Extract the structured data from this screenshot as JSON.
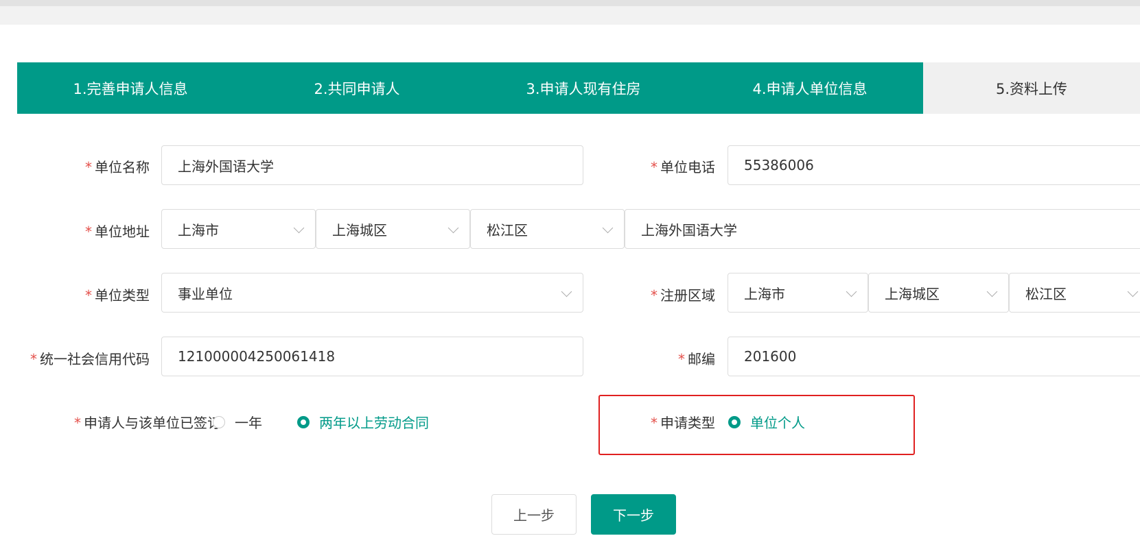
{
  "steps": [
    {
      "label": "1.完善申请人信息",
      "active": true
    },
    {
      "label": "2.共同申请人",
      "active": true
    },
    {
      "label": "3.申请人现有住房",
      "active": true
    },
    {
      "label": "4.申请人单位信息",
      "active": true
    },
    {
      "label": "5.资料上传",
      "active": false
    }
  ],
  "required_mark": "*",
  "form": {
    "company_name": {
      "label": "单位名称",
      "value": "上海外国语大学"
    },
    "company_phone": {
      "label": "单位电话",
      "value": "55386006"
    },
    "company_address": {
      "label": "单位地址",
      "province": "上海市",
      "city": "上海城区",
      "district": "松江区",
      "detail": "上海外国语大学"
    },
    "company_type": {
      "label": "单位类型",
      "value": "事业单位"
    },
    "register_region": {
      "label": "注册区域",
      "province": "上海市",
      "city": "上海城区",
      "district": "松江区"
    },
    "credit_code": {
      "label": "统一社会信用代码",
      "value": "121000004250061418"
    },
    "postcode": {
      "label": "邮编",
      "value": "201600"
    },
    "contract": {
      "label": "申请人与该单位已签订",
      "options": [
        "一年",
        "两年以上劳动合同"
      ],
      "selected": "两年以上劳动合同"
    },
    "apply_type": {
      "label": "申请类型",
      "options": [
        "单位个人"
      ],
      "selected": "单位个人"
    }
  },
  "buttons": {
    "prev": "上一步",
    "next": "下一步"
  },
  "colors": {
    "accent": "#009a88",
    "required": "#e4504b",
    "highlight": "#e02020"
  }
}
